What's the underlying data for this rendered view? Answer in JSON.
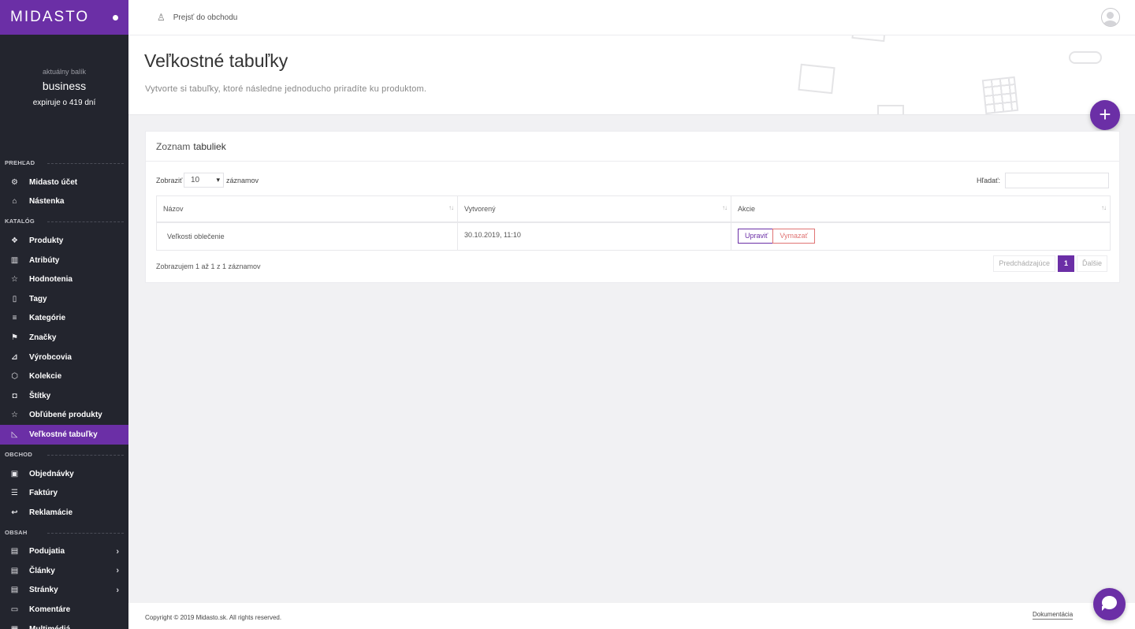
{
  "brand": {
    "logo": "MIDASTO"
  },
  "plan": {
    "label": "aktuálny balík",
    "name": "business",
    "expires": "expiruje o 419 dní"
  },
  "sidebar": {
    "sections": [
      {
        "title": "PREHĽAD",
        "items": [
          {
            "label": "Midasto účet",
            "icon": "gear-icon",
            "glyph": "⚙"
          },
          {
            "label": "Nástenka",
            "icon": "home-icon",
            "glyph": "⌂"
          }
        ]
      },
      {
        "title": "KATALÓG",
        "items": [
          {
            "label": "Produkty",
            "icon": "products-icon",
            "glyph": "❖"
          },
          {
            "label": "Atribúty",
            "icon": "attributes-icon",
            "glyph": "▥"
          },
          {
            "label": "Hodnotenia",
            "icon": "star-icon",
            "glyph": "☆"
          },
          {
            "label": "Tagy",
            "icon": "bookmark-icon",
            "glyph": "▯"
          },
          {
            "label": "Kategórie",
            "icon": "list-icon",
            "glyph": "≡"
          },
          {
            "label": "Značky",
            "icon": "signpost-icon",
            "glyph": "⚑"
          },
          {
            "label": "Výrobcovia",
            "icon": "factory-icon",
            "glyph": "⊿"
          },
          {
            "label": "Kolekcie",
            "icon": "box-icon",
            "glyph": "⬡"
          },
          {
            "label": "Štítky",
            "icon": "label-icon",
            "glyph": "◘"
          },
          {
            "label": "Obľúbené produkty",
            "icon": "star-icon",
            "glyph": "☆"
          },
          {
            "label": "Veľkostné tabuľky",
            "icon": "ruler-icon",
            "glyph": "◺",
            "active": true
          }
        ]
      },
      {
        "title": "OBCHOD",
        "items": [
          {
            "label": "Objednávky",
            "icon": "orders-icon",
            "glyph": "▣"
          },
          {
            "label": "Faktúry",
            "icon": "invoice-icon",
            "glyph": "☰"
          },
          {
            "label": "Reklamácie",
            "icon": "return-icon",
            "glyph": "↩"
          }
        ]
      },
      {
        "title": "OBSAH",
        "items": [
          {
            "label": "Podujatia",
            "icon": "document-icon",
            "glyph": "▤",
            "chevron": "›"
          },
          {
            "label": "Články",
            "icon": "document-icon",
            "glyph": "▤",
            "chevron": "›"
          },
          {
            "label": "Stránky",
            "icon": "document-icon",
            "glyph": "▤",
            "chevron": "›"
          },
          {
            "label": "Komentáre",
            "icon": "comment-icon",
            "glyph": "▭"
          },
          {
            "label": "Multimédiá",
            "icon": "media-icon",
            "glyph": "▦"
          }
        ]
      }
    ]
  },
  "topbar": {
    "store_link": "Prejsť do obchodu",
    "store_icon": "store-icon"
  },
  "header": {
    "title": "Veľkostné tabuľky",
    "subtitle": "Vytvorte si tabuľky, ktoré následne jednoducho priradíte ku produktom.",
    "add_button": "+"
  },
  "card": {
    "title_prefix": "Zoznam",
    "title_strong": "tabuliek",
    "length_before": "Zobraziť",
    "length_value": "10",
    "length_after": "záznamov",
    "search_label": "Hľadať:",
    "search_placeholder": "",
    "columns": [
      {
        "label": "Názov",
        "sort": "↑↓"
      },
      {
        "label": "Vytvorený",
        "sort": "↑↓"
      },
      {
        "label": "Akcie",
        "sort": "↑↓"
      }
    ],
    "rows": [
      {
        "name": "Veľkosti oblečenie",
        "created": "30.10.2019, 11:10",
        "edit": "Upraviť",
        "delete": "Vymazať"
      }
    ],
    "info": "Zobrazujem 1 až 1 z 1 záznamov",
    "pager": {
      "prev": "Predchádzajúce",
      "current": "1",
      "next": "Ďalšie"
    }
  },
  "footer": {
    "copyright": "Copyright © 2019 Midasto.sk. All rights reserved.",
    "docs": "Dokumentácia"
  },
  "colors": {
    "accent": "#6b2fa6",
    "sidebar": "#23252e",
    "danger": "#e07474"
  }
}
